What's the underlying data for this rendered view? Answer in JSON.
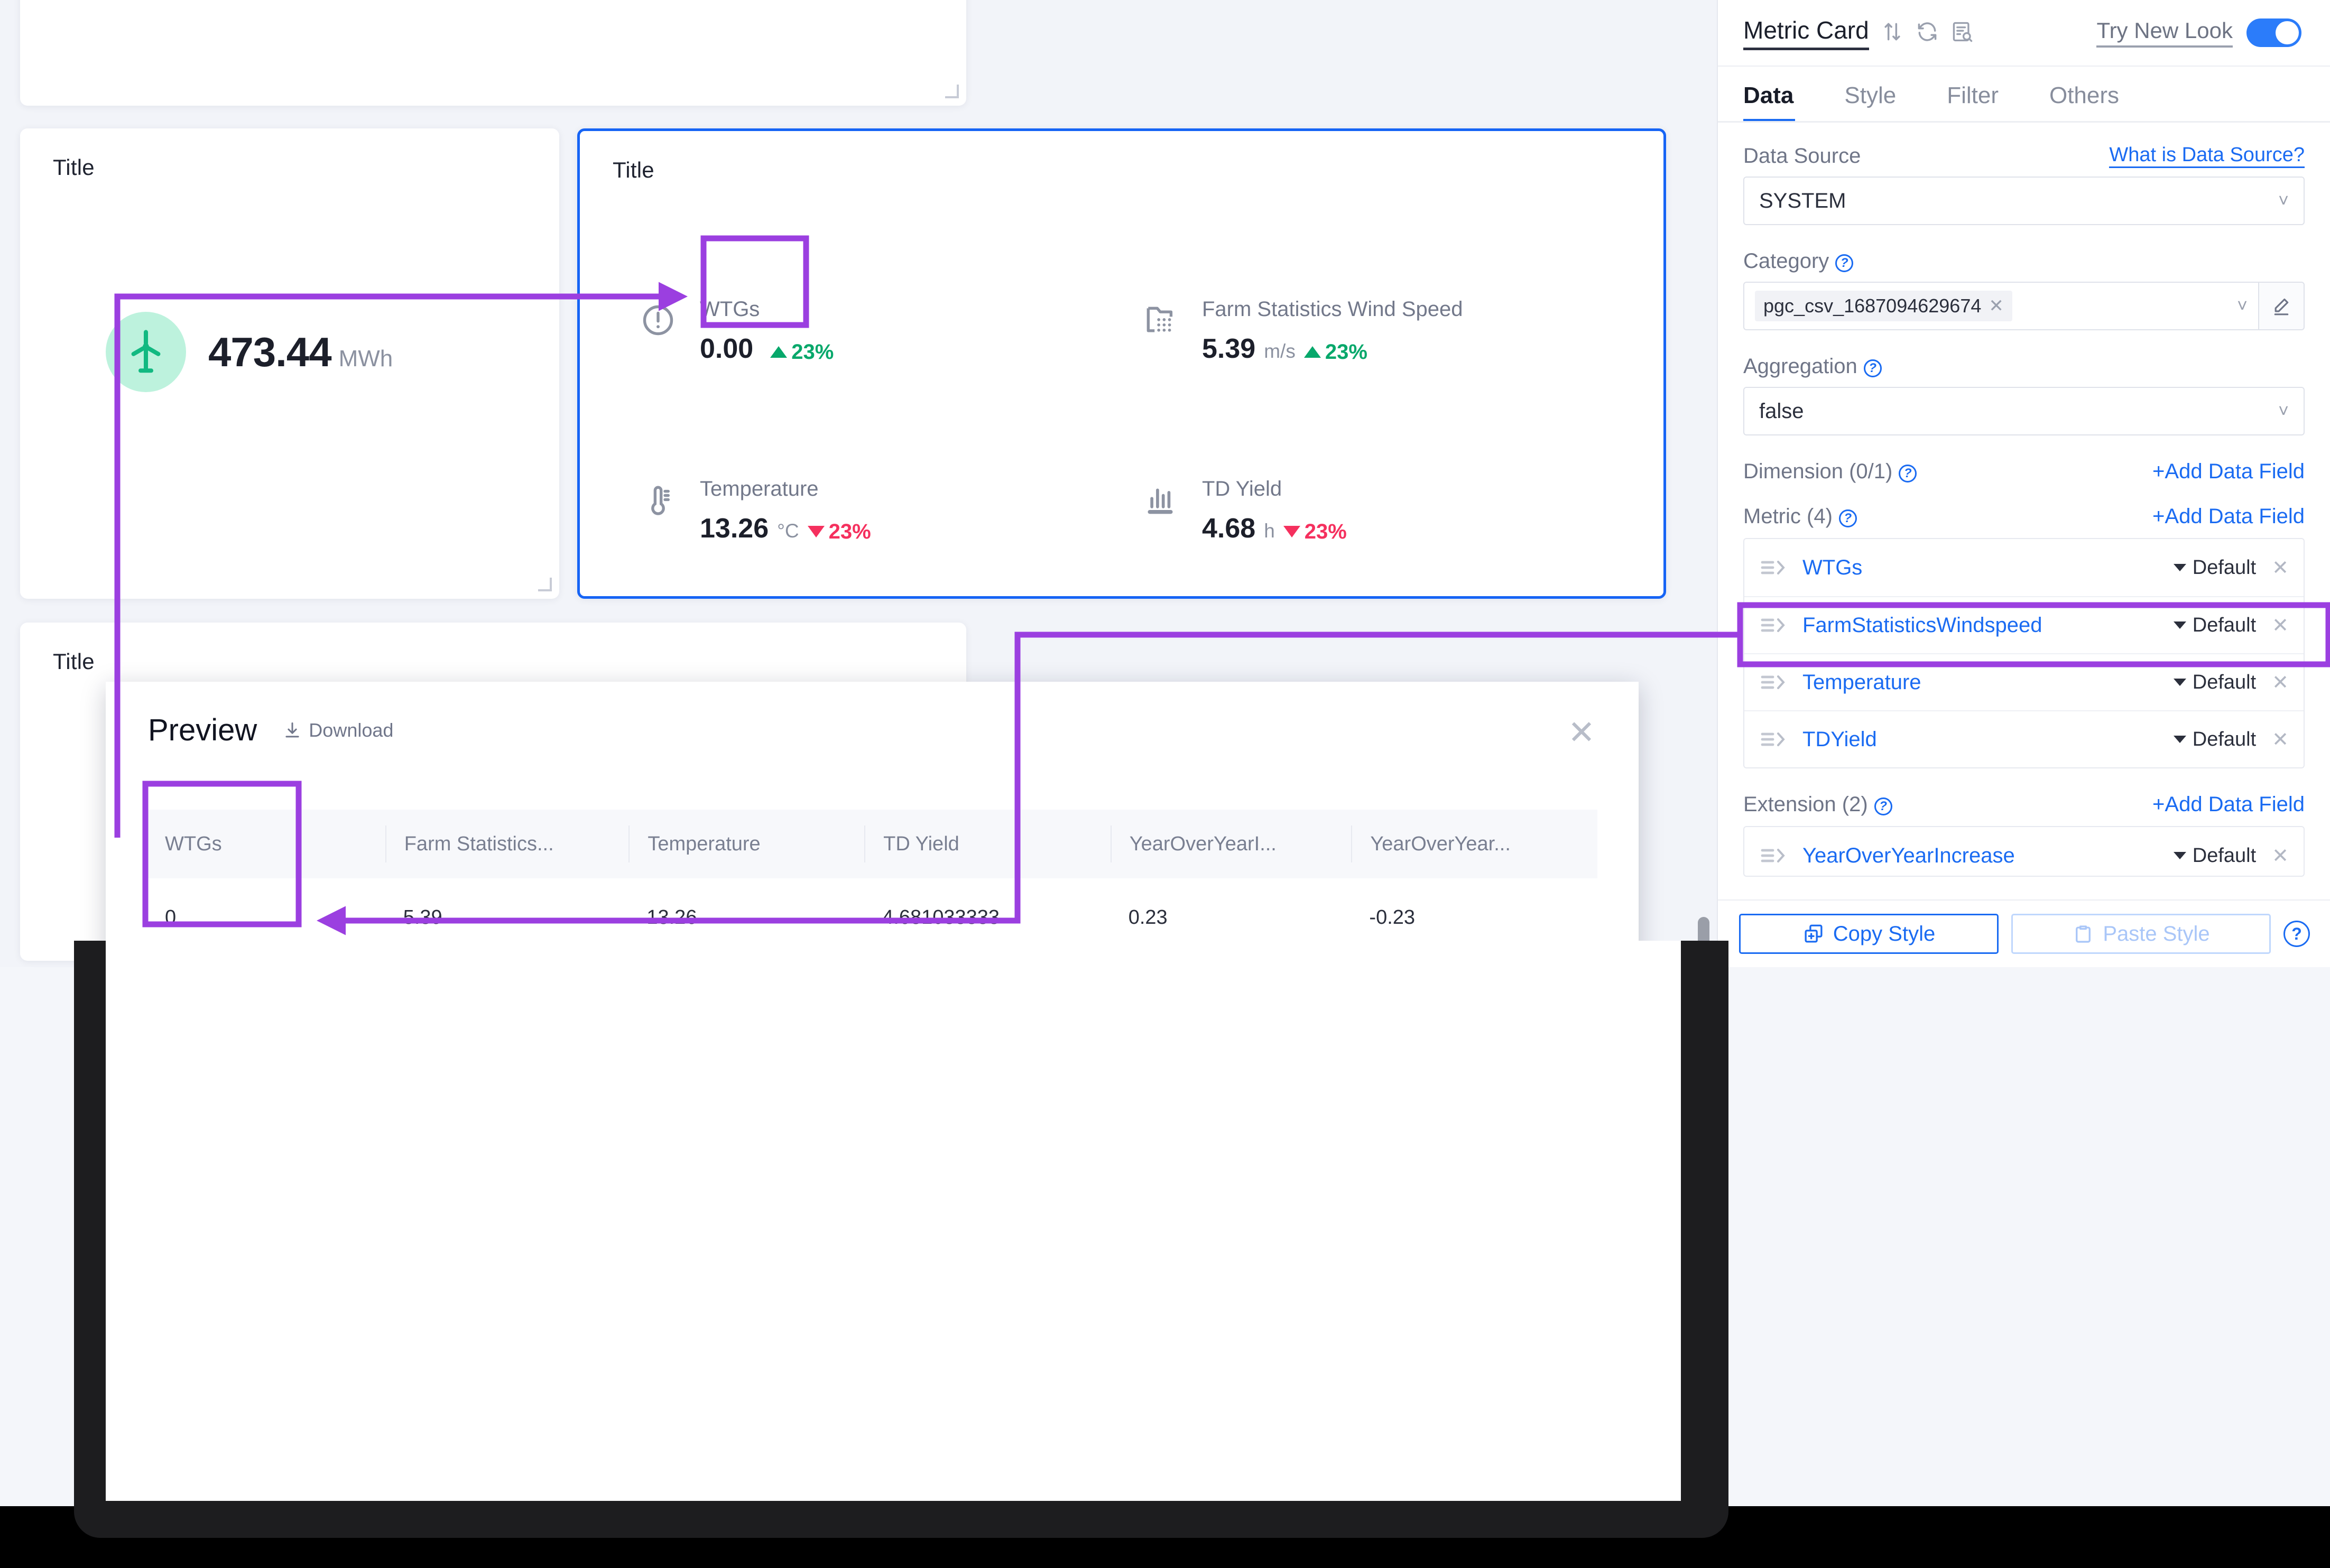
{
  "canvas": {
    "cards": [
      {
        "title": ""
      },
      {
        "title": "Title"
      },
      {
        "title": "Title"
      },
      {
        "title": "Title"
      }
    ],
    "energy_card": {
      "value": "473.44",
      "unit": "MWh",
      "icon": "wind-turbine-icon",
      "icon_bg": "#bdf2dd",
      "icon_color": "#12b981"
    },
    "metrics": [
      {
        "icon": "alert-circle-icon",
        "label": "WTGs",
        "value": "0.00",
        "unit": "",
        "delta": "23%",
        "direction": "up"
      },
      {
        "icon": "wind-farm-icon",
        "label": "Farm Statistics Wind Speed",
        "value": "5.39",
        "unit": "m/s",
        "delta": "23%",
        "direction": "up"
      },
      {
        "icon": "thermometer-icon",
        "label": "Temperature",
        "value": "13.26",
        "unit": "°C",
        "delta": "23%",
        "direction": "down"
      },
      {
        "icon": "bar-chart-icon",
        "label": "TD Yield",
        "value": "4.68",
        "unit": "h",
        "delta": "23%",
        "direction": "down"
      }
    ]
  },
  "preview": {
    "title": "Preview",
    "download_label": "Download",
    "close_label": "✕",
    "columns": [
      "WTGs",
      "Farm Statistics...",
      "Temperature",
      "TD Yield",
      "YearOverYearI...",
      "YearOverYear..."
    ],
    "rows": [
      [
        "0",
        "5.39",
        "13.26",
        "4.681033333",
        "0.23",
        "-0.23"
      ]
    ]
  },
  "panel": {
    "title": "Metric Card",
    "header_icons": [
      "sort-icon",
      "refresh-icon",
      "inspect-data-icon"
    ],
    "try_new_look": "Try New Look",
    "toggle_on": true,
    "tabs": [
      {
        "label": "Data",
        "active": true
      },
      {
        "label": "Style",
        "active": false
      },
      {
        "label": "Filter",
        "active": false
      },
      {
        "label": "Others",
        "active": false
      }
    ],
    "data_source": {
      "label": "Data Source",
      "help_link": "What is Data Source?",
      "value": "SYSTEM"
    },
    "category": {
      "label": "Category",
      "chip": "pgc_csv_1687094629674",
      "chip_remove": "✕",
      "edit_icon": "pencil-icon"
    },
    "aggregation": {
      "label": "Aggregation",
      "value": "false"
    },
    "dimension": {
      "label": "Dimension (0/1)",
      "add_label": "+Add Data Field"
    },
    "metric": {
      "label": "Metric (4)",
      "add_label": "+Add Data Field",
      "items": [
        {
          "name": "WTGs",
          "agg": "Default",
          "remove": "✕"
        },
        {
          "name": "FarmStatisticsWindspeed",
          "agg": "Default",
          "remove": "✕"
        },
        {
          "name": "Temperature",
          "agg": "Default",
          "remove": "✕"
        },
        {
          "name": "TDYield",
          "agg": "Default",
          "remove": "✕"
        }
      ]
    },
    "extension": {
      "label": "Extension (2)",
      "add_label": "+Add Data Field",
      "items": [
        {
          "name": "YearOverYearIncrease",
          "agg": "Default",
          "remove": "✕"
        }
      ]
    },
    "footer": {
      "copy_label": "Copy Style",
      "paste_label": "Paste Style",
      "help": "?"
    }
  },
  "annotation": {
    "color": "#9b3fe0",
    "highlights": [
      "metric-wtgs-value",
      "preview-wtgs-column",
      "panel-metric-wtgs-row"
    ]
  }
}
